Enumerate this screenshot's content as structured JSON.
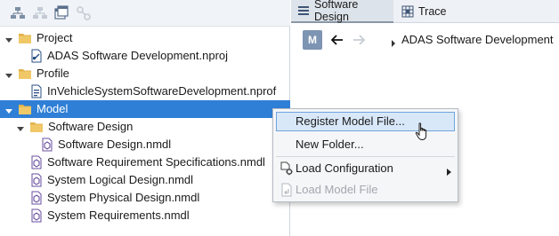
{
  "toolbar": {
    "icons": [
      "hierarchy-icon",
      "hierarchy-disabled-icon",
      "copy-window-icon",
      "link-disabled-icon"
    ]
  },
  "tree": {
    "project": {
      "label": "Project",
      "child": "ADAS Software Development.nproj"
    },
    "profile": {
      "label": "Profile",
      "child": "InVehicleSystemSoftwareDevelopment.nprof"
    },
    "model": {
      "label": "Model",
      "software_design": {
        "label": "Software Design",
        "child": "Software Design.nmdl"
      },
      "files": [
        "Software Requirement Specifications.nmdl",
        "System Logical Design.nmdl",
        "System Physical Design.nmdl",
        "System Requirements.nmdl"
      ]
    }
  },
  "tabs": [
    {
      "label": "Software Design",
      "icon": "list-icon",
      "active": true
    },
    {
      "label": "Trace",
      "icon": "trace-grid-icon",
      "active": false
    }
  ],
  "nav": {
    "badge": "M",
    "breadcrumb": "ADAS Software Development"
  },
  "context_menu": {
    "register": "Register Model File...",
    "new_folder": "New Folder...",
    "load_configuration": "Load Configuration",
    "load_model_file": "Load Model File"
  },
  "colors": {
    "selection": "#2f7fd6",
    "folder": "#e2b24a",
    "menu_hover": "#d9e8f9"
  }
}
